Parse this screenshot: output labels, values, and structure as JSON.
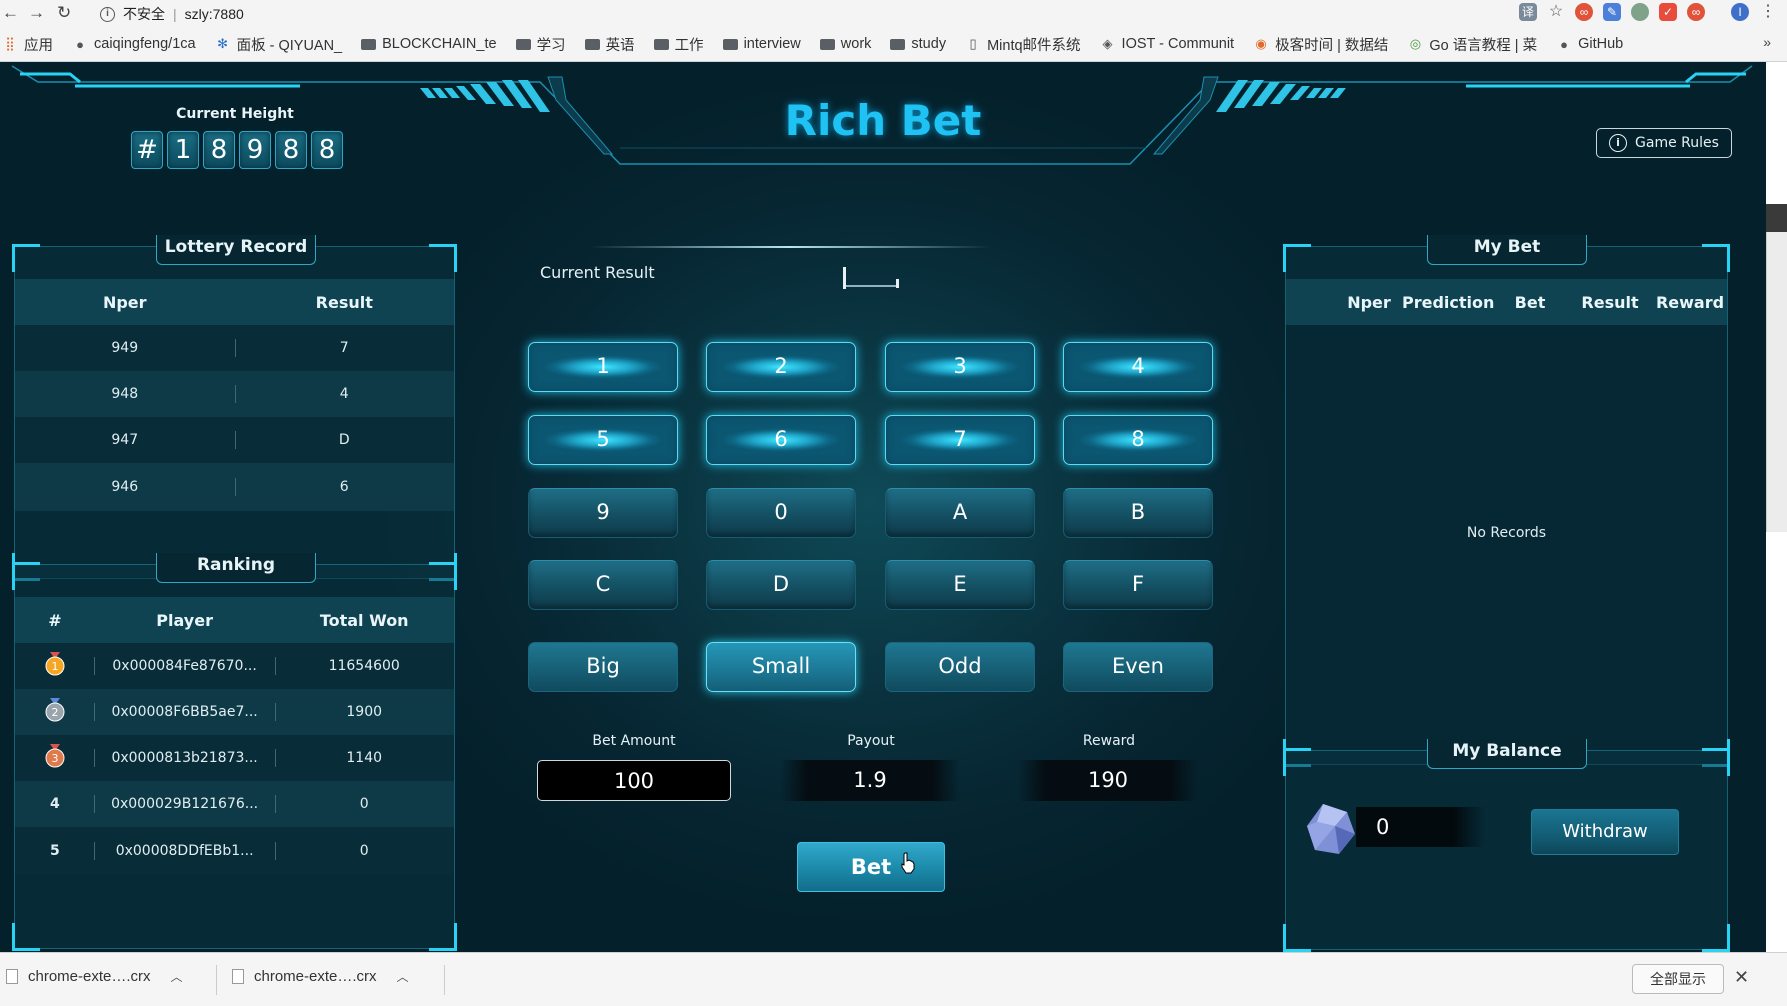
{
  "browser": {
    "insecure_label": "不安全",
    "url": "szly:7880",
    "apps_label": "应用",
    "bookmarks": [
      "caiqingfeng/1ca",
      "面板 - QIYUAN_",
      "BLOCKCHAIN_te",
      "学习",
      "英语",
      "工作",
      "interview",
      "work",
      "study",
      "Mintq邮件系统",
      "IOST - Communit",
      "极客时间 | 数据结",
      "Go 语言教程 | 菜",
      "GitHub"
    ],
    "more": "»"
  },
  "header": {
    "title": "Rich Bet",
    "height_label": "Current Height",
    "height_digits": [
      "#",
      "1",
      "8",
      "9",
      "8",
      "8"
    ],
    "rules_label": "Game Rules"
  },
  "lottery": {
    "title": "Lottery Record",
    "headers": [
      "Nper",
      "Result"
    ],
    "rows": [
      {
        "nper": "949",
        "result": "7"
      },
      {
        "nper": "948",
        "result": "4"
      },
      {
        "nper": "947",
        "result": "D"
      },
      {
        "nper": "946",
        "result": "6"
      }
    ]
  },
  "ranking": {
    "title": "Ranking",
    "headers": [
      "#",
      "Player",
      "Total Won"
    ],
    "rows": [
      {
        "rank": "1",
        "player": "0x000084Fe87670...",
        "won": "11654600",
        "medal": "gold"
      },
      {
        "rank": "2",
        "player": "0x00008F6BB5ae7...",
        "won": "1900",
        "medal": "silver"
      },
      {
        "rank": "3",
        "player": "0x0000813b21873...",
        "won": "1140",
        "medal": "bronze"
      },
      {
        "rank": "4",
        "player": "0x000029B121676...",
        "won": "0"
      },
      {
        "rank": "5",
        "player": "0x00008DDfEBb1...",
        "won": "0"
      }
    ]
  },
  "center": {
    "current_result_label": "Current Result",
    "keys": [
      "1",
      "2",
      "3",
      "4",
      "5",
      "6",
      "7",
      "8",
      "9",
      "0",
      "A",
      "B",
      "C",
      "D",
      "E",
      "F"
    ],
    "modes": [
      "Big",
      "Small",
      "Odd",
      "Even"
    ],
    "selected_mode": "Small",
    "bet_amount_label": "Bet Amount",
    "bet_amount": "100",
    "payout_label": "Payout",
    "payout": "1.9",
    "reward_label": "Reward",
    "reward": "190",
    "bet_button": "Bet"
  },
  "mybet": {
    "title": "My Bet",
    "headers": [
      "Nper",
      "Prediction",
      "Bet",
      "Result",
      "Reward"
    ],
    "empty": "No Records"
  },
  "balance": {
    "title": "My Balance",
    "value": "0",
    "withdraw": "Withdraw"
  },
  "downloads": {
    "items": [
      "chrome-exte….crx",
      "chrome-exte….crx"
    ],
    "show_all": "全部显示",
    "close": "✕"
  },
  "colors": {
    "accent": "#1ec3f4",
    "panel_border": "#29d3f5"
  }
}
